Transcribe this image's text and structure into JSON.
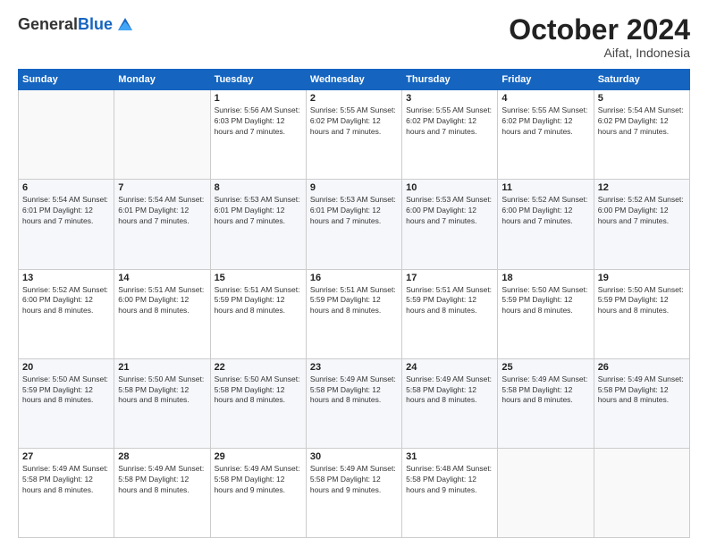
{
  "header": {
    "logo_general": "General",
    "logo_blue": "Blue",
    "month_year": "October 2024",
    "location": "Aifat, Indonesia"
  },
  "days_of_week": [
    "Sunday",
    "Monday",
    "Tuesday",
    "Wednesday",
    "Thursday",
    "Friday",
    "Saturday"
  ],
  "weeks": [
    [
      {
        "day": "",
        "info": ""
      },
      {
        "day": "",
        "info": ""
      },
      {
        "day": "1",
        "info": "Sunrise: 5:56 AM\nSunset: 6:03 PM\nDaylight: 12 hours\nand 7 minutes."
      },
      {
        "day": "2",
        "info": "Sunrise: 5:55 AM\nSunset: 6:02 PM\nDaylight: 12 hours\nand 7 minutes."
      },
      {
        "day": "3",
        "info": "Sunrise: 5:55 AM\nSunset: 6:02 PM\nDaylight: 12 hours\nand 7 minutes."
      },
      {
        "day": "4",
        "info": "Sunrise: 5:55 AM\nSunset: 6:02 PM\nDaylight: 12 hours\nand 7 minutes."
      },
      {
        "day": "5",
        "info": "Sunrise: 5:54 AM\nSunset: 6:02 PM\nDaylight: 12 hours\nand 7 minutes."
      }
    ],
    [
      {
        "day": "6",
        "info": "Sunrise: 5:54 AM\nSunset: 6:01 PM\nDaylight: 12 hours\nand 7 minutes."
      },
      {
        "day": "7",
        "info": "Sunrise: 5:54 AM\nSunset: 6:01 PM\nDaylight: 12 hours\nand 7 minutes."
      },
      {
        "day": "8",
        "info": "Sunrise: 5:53 AM\nSunset: 6:01 PM\nDaylight: 12 hours\nand 7 minutes."
      },
      {
        "day": "9",
        "info": "Sunrise: 5:53 AM\nSunset: 6:01 PM\nDaylight: 12 hours\nand 7 minutes."
      },
      {
        "day": "10",
        "info": "Sunrise: 5:53 AM\nSunset: 6:00 PM\nDaylight: 12 hours\nand 7 minutes."
      },
      {
        "day": "11",
        "info": "Sunrise: 5:52 AM\nSunset: 6:00 PM\nDaylight: 12 hours\nand 7 minutes."
      },
      {
        "day": "12",
        "info": "Sunrise: 5:52 AM\nSunset: 6:00 PM\nDaylight: 12 hours\nand 7 minutes."
      }
    ],
    [
      {
        "day": "13",
        "info": "Sunrise: 5:52 AM\nSunset: 6:00 PM\nDaylight: 12 hours\nand 8 minutes."
      },
      {
        "day": "14",
        "info": "Sunrise: 5:51 AM\nSunset: 6:00 PM\nDaylight: 12 hours\nand 8 minutes."
      },
      {
        "day": "15",
        "info": "Sunrise: 5:51 AM\nSunset: 5:59 PM\nDaylight: 12 hours\nand 8 minutes."
      },
      {
        "day": "16",
        "info": "Sunrise: 5:51 AM\nSunset: 5:59 PM\nDaylight: 12 hours\nand 8 minutes."
      },
      {
        "day": "17",
        "info": "Sunrise: 5:51 AM\nSunset: 5:59 PM\nDaylight: 12 hours\nand 8 minutes."
      },
      {
        "day": "18",
        "info": "Sunrise: 5:50 AM\nSunset: 5:59 PM\nDaylight: 12 hours\nand 8 minutes."
      },
      {
        "day": "19",
        "info": "Sunrise: 5:50 AM\nSunset: 5:59 PM\nDaylight: 12 hours\nand 8 minutes."
      }
    ],
    [
      {
        "day": "20",
        "info": "Sunrise: 5:50 AM\nSunset: 5:59 PM\nDaylight: 12 hours\nand 8 minutes."
      },
      {
        "day": "21",
        "info": "Sunrise: 5:50 AM\nSunset: 5:58 PM\nDaylight: 12 hours\nand 8 minutes."
      },
      {
        "day": "22",
        "info": "Sunrise: 5:50 AM\nSunset: 5:58 PM\nDaylight: 12 hours\nand 8 minutes."
      },
      {
        "day": "23",
        "info": "Sunrise: 5:49 AM\nSunset: 5:58 PM\nDaylight: 12 hours\nand 8 minutes."
      },
      {
        "day": "24",
        "info": "Sunrise: 5:49 AM\nSunset: 5:58 PM\nDaylight: 12 hours\nand 8 minutes."
      },
      {
        "day": "25",
        "info": "Sunrise: 5:49 AM\nSunset: 5:58 PM\nDaylight: 12 hours\nand 8 minutes."
      },
      {
        "day": "26",
        "info": "Sunrise: 5:49 AM\nSunset: 5:58 PM\nDaylight: 12 hours\nand 8 minutes."
      }
    ],
    [
      {
        "day": "27",
        "info": "Sunrise: 5:49 AM\nSunset: 5:58 PM\nDaylight: 12 hours\nand 8 minutes."
      },
      {
        "day": "28",
        "info": "Sunrise: 5:49 AM\nSunset: 5:58 PM\nDaylight: 12 hours\nand 8 minutes."
      },
      {
        "day": "29",
        "info": "Sunrise: 5:49 AM\nSunset: 5:58 PM\nDaylight: 12 hours\nand 9 minutes."
      },
      {
        "day": "30",
        "info": "Sunrise: 5:49 AM\nSunset: 5:58 PM\nDaylight: 12 hours\nand 9 minutes."
      },
      {
        "day": "31",
        "info": "Sunrise: 5:48 AM\nSunset: 5:58 PM\nDaylight: 12 hours\nand 9 minutes."
      },
      {
        "day": "",
        "info": ""
      },
      {
        "day": "",
        "info": ""
      }
    ]
  ]
}
